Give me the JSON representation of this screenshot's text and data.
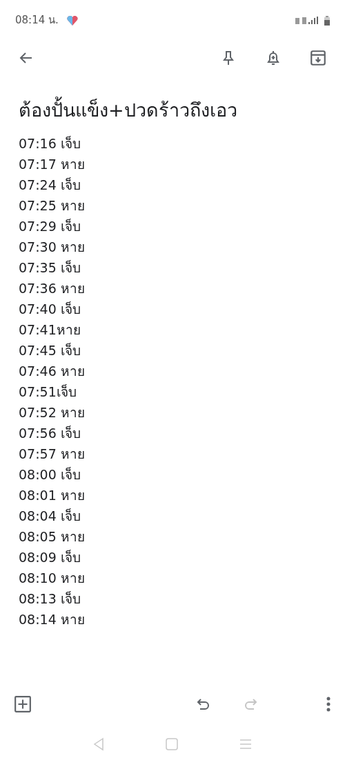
{
  "status_bar": {
    "time": "08:14 น."
  },
  "title": "ต้องปั้นแข็ง+ปวดร้าวถึงเอว",
  "lines": [
    "07:16 เจ็บ",
    "07:17 หาย",
    "07:24 เจ็บ",
    "07:25 หาย",
    "07:29 เจ็บ",
    "07:30 หาย",
    "07:35 เจ็บ",
    "07:36 หาย",
    "07:40 เจ็บ",
    "07:41หาย",
    "07:45 เจ็บ",
    "07:46 หาย",
    "07:51เจ็บ",
    "07:52 หาย",
    "07:56 เจ็บ",
    "07:57 หาย",
    "08:00 เจ็บ",
    "08:01 หาย",
    "08:04 เจ็บ",
    "08:05 หาย",
    "08:09 เจ็บ",
    "08:10 หาย",
    "08:13 เจ็บ",
    "08:14 หาย"
  ],
  "bottom_bar": {
    "undo_disabled": false,
    "redo_disabled": true
  }
}
